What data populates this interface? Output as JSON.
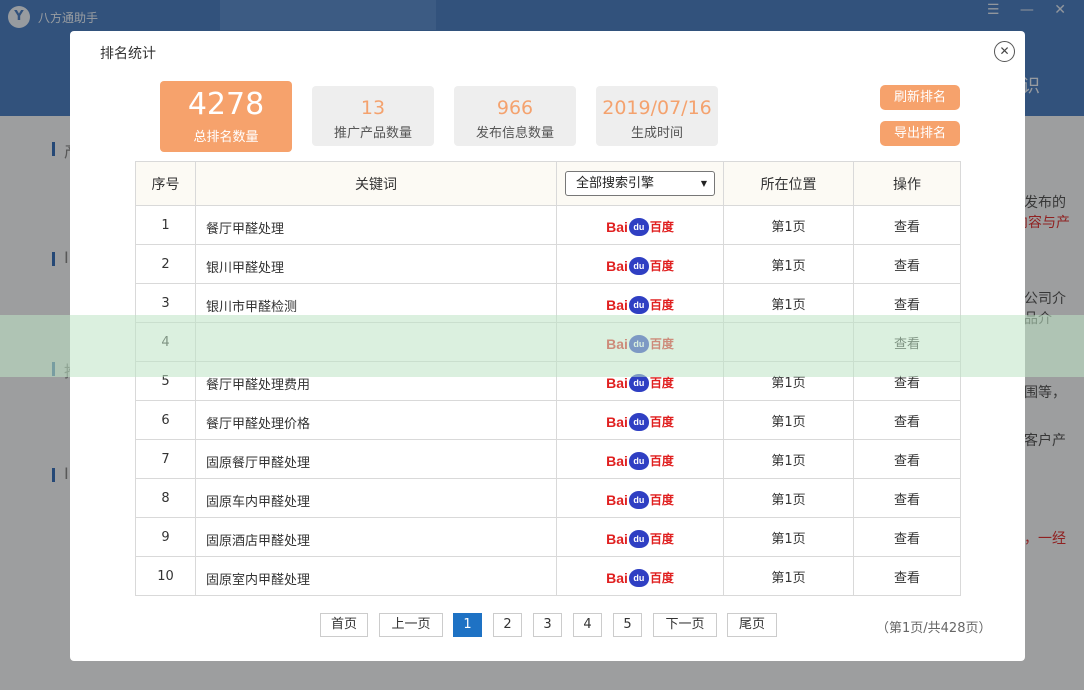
{
  "app": {
    "logo_glyph": "Y",
    "title": "八方通助手",
    "window_controls": "☰ —  ✕",
    "nav_right_text": "识"
  },
  "background": {
    "left_snippets": [
      "产",
      "I",
      "推",
      "I"
    ],
    "right_snippets": [
      {
        "text": "发布的",
        "red": false
      },
      {
        "text": "内容与产",
        "red": true
      },
      {
        "text": "公司介",
        "red": false
      },
      {
        "text": "品介",
        "red": false
      },
      {
        "text": "围等，",
        "red": false
      },
      {
        "text": "客户产",
        "red": false
      },
      {
        "text": "，一经",
        "red": true
      }
    ]
  },
  "modal": {
    "title": "排名统计",
    "close_glyph": "✕",
    "stats": [
      {
        "value": "4278",
        "label": "总排名数量"
      },
      {
        "value": "13",
        "label": "推广产品数量"
      },
      {
        "value": "966",
        "label": "发布信息数量"
      },
      {
        "value": "2019/07/16",
        "label": "生成时间"
      }
    ],
    "buttons": {
      "refresh": "刷新排名",
      "export": "导出排名"
    }
  },
  "table": {
    "headers": {
      "index": "序号",
      "keyword": "关键词",
      "position": "所在位置",
      "action": "操作"
    },
    "engine_select": "全部搜索引擎",
    "engine_logo": {
      "bai": "Bai",
      "du": "du",
      "cn": "百度"
    },
    "rows": [
      {
        "index": "1",
        "keyword": "餐厅甲醛处理",
        "position": "第1页",
        "action": "查看"
      },
      {
        "index": "2",
        "keyword": "银川甲醛处理",
        "position": "第1页",
        "action": "查看"
      },
      {
        "index": "3",
        "keyword": "银川市甲醛检测",
        "position": "第1页",
        "action": "查看"
      },
      {
        "index": "4",
        "keyword": "",
        "position": "",
        "action": "查看"
      },
      {
        "index": "5",
        "keyword": "餐厅甲醛处理费用",
        "position": "第1页",
        "action": "查看"
      },
      {
        "index": "6",
        "keyword": "餐厅甲醛处理价格",
        "position": "第1页",
        "action": "查看"
      },
      {
        "index": "7",
        "keyword": "固原餐厅甲醛处理",
        "position": "第1页",
        "action": "查看"
      },
      {
        "index": "8",
        "keyword": "固原车内甲醛处理",
        "position": "第1页",
        "action": "查看"
      },
      {
        "index": "9",
        "keyword": "固原酒店甲醛处理",
        "position": "第1页",
        "action": "查看"
      },
      {
        "index": "10",
        "keyword": "固原室内甲醛处理",
        "position": "第1页",
        "action": "查看"
      }
    ]
  },
  "pagination": {
    "first": "首页",
    "prev": "上一页",
    "pages": [
      "1",
      "2",
      "3",
      "4",
      "5"
    ],
    "active_page": "1",
    "next": "下一页",
    "last": "尾页",
    "info": "（第1页/共428页）"
  },
  "colors": {
    "accent_orange": "#f6a26c",
    "primary_blue": "#1e72c4",
    "titlebar_blue": "#4d7fbf"
  }
}
